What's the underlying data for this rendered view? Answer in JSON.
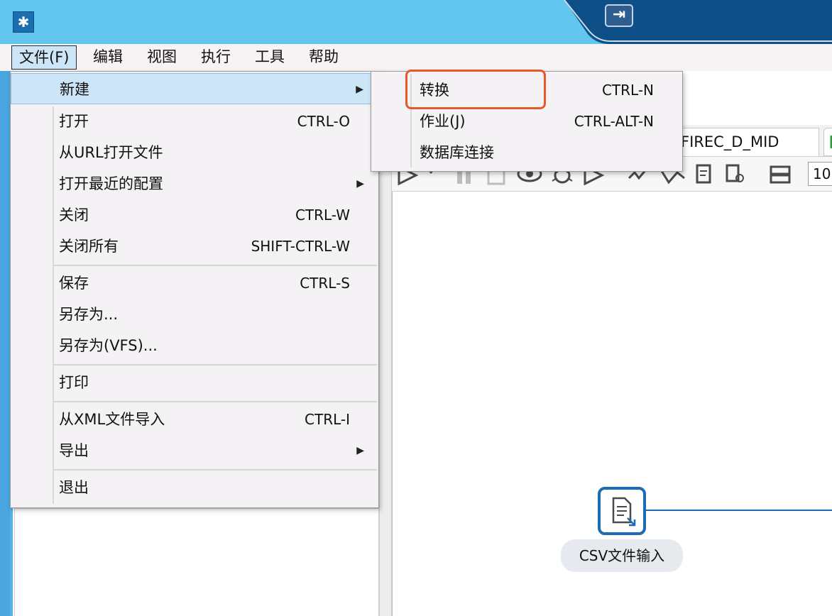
{
  "menubar": {
    "file": "文件(F)",
    "edit": "编辑",
    "view": "视图",
    "run": "执行",
    "tools": "工具",
    "help": "帮助"
  },
  "file_menu": {
    "items": [
      {
        "label": "新建",
        "shortcut": "",
        "submenu": true
      },
      {
        "label": "打开",
        "shortcut": "CTRL-O"
      },
      {
        "label": "从URL打开文件",
        "shortcut": ""
      },
      {
        "label": "打开最近的配置",
        "shortcut": "",
        "submenu": true
      },
      {
        "label": "关闭",
        "shortcut": "CTRL-W"
      },
      {
        "label": "关闭所有",
        "shortcut": "SHIFT-CTRL-W"
      },
      {
        "label": "保存",
        "shortcut": "CTRL-S"
      },
      {
        "label": "另存为...",
        "shortcut": ""
      },
      {
        "label": "另存为(VFS)...",
        "shortcut": ""
      },
      {
        "label": "打印",
        "shortcut": ""
      },
      {
        "label": "从XML文件导入",
        "shortcut": "CTRL-I"
      },
      {
        "label": "导出",
        "shortcut": "",
        "submenu": true
      },
      {
        "label": "退出",
        "shortcut": ""
      }
    ]
  },
  "new_submenu": {
    "items": [
      {
        "label": "转换",
        "shortcut": "CTRL-N"
      },
      {
        "label": "作业(J)",
        "shortcut": "CTRL-ALT-N"
      },
      {
        "label": "数据库连接",
        "shortcut": ""
      }
    ]
  },
  "editor": {
    "tab_title": "FIREC_D_MID",
    "zoom": "10"
  },
  "canvas": {
    "step_label": "CSV文件输入"
  },
  "colors": {
    "titlebar": "#62c6ee",
    "highlight": "#e8592a",
    "selected": "#cde6f7",
    "step_border": "#1d6bb0"
  }
}
